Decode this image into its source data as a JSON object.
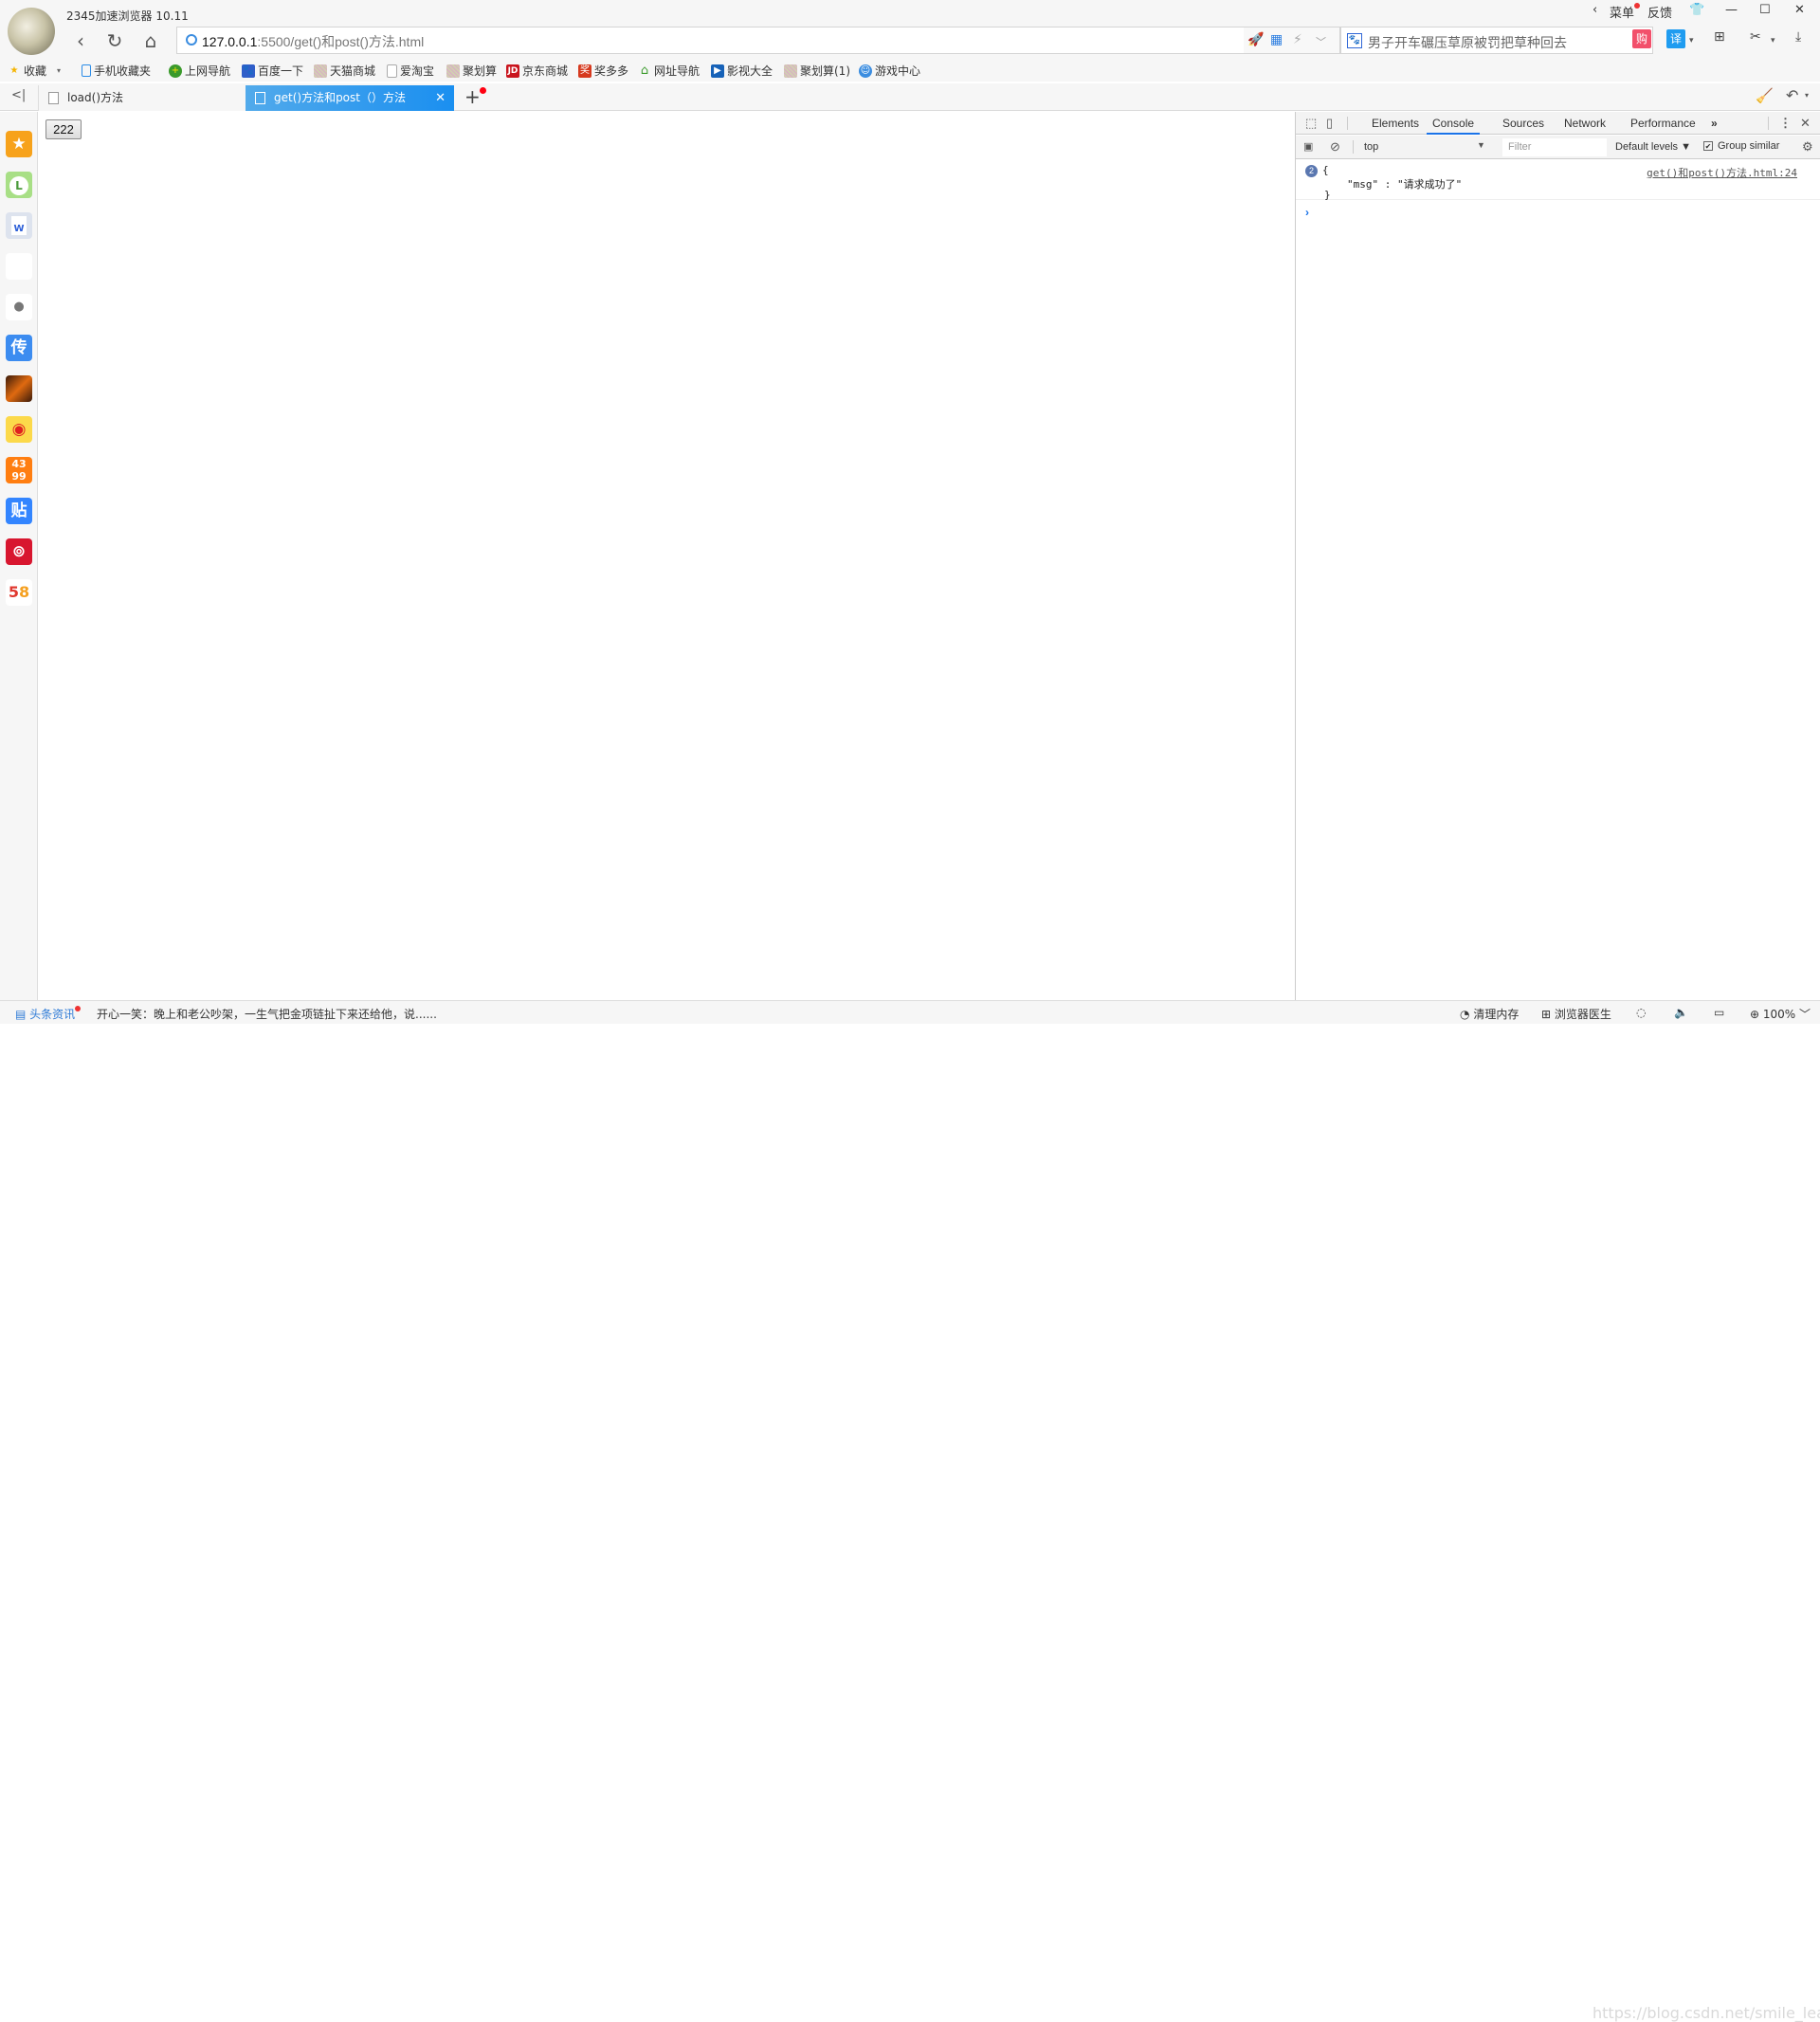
{
  "app": {
    "title": "2345加速浏览器 10.11"
  },
  "window_controls": {
    "menu_label": "菜单",
    "feedback_label": "反馈"
  },
  "addressbar": {
    "url_host": "127.0.0.1",
    "url_rest": ":5500/get()和post()方法.html"
  },
  "search": {
    "text": "男子开车碾压草原被罚把草种回去"
  },
  "bookmarks": [
    {
      "label": "收藏",
      "icon": "star-icon",
      "color": "#f5b400"
    },
    {
      "label": "手机收藏夹",
      "icon": "phone-icon",
      "color": "#2b8ce8"
    },
    {
      "label": "上网导航",
      "icon": "nav-plus-icon",
      "color": "#3a9a2b"
    },
    {
      "label": "百度一下",
      "icon": "baidu-paw-icon",
      "color": "#2f5ec9"
    },
    {
      "label": "天猫商城",
      "icon": "tmall-icon",
      "color": "#d9a8c8"
    },
    {
      "label": "爱淘宝",
      "icon": "page-icon",
      "color": "#bbbbbb"
    },
    {
      "label": "聚划算",
      "icon": "juhuasuan-icon",
      "color": "#d9a8c8"
    },
    {
      "label": "京东商城",
      "icon": "jd-icon",
      "color": "#c9151e"
    },
    {
      "label": "奖多多",
      "icon": "jiang-icon",
      "color": "#d63a1f"
    },
    {
      "label": "网址导航",
      "icon": "house-icon",
      "color": "#3a9a2b"
    },
    {
      "label": "影视大全",
      "icon": "video-icon",
      "color": "#1762b8"
    },
    {
      "label": "聚划算(1)",
      "icon": "juhuasuan-icon",
      "color": "#d9a8c8"
    },
    {
      "label": "游戏中心",
      "icon": "game-mascot-icon",
      "color": "#3b8de0"
    }
  ],
  "tabs": [
    {
      "label": "load()方法",
      "active": false
    },
    {
      "label": "get()方法和post（）方法",
      "active": true
    }
  ],
  "sidebar": [
    {
      "name": "favorites",
      "glyph": "★",
      "bg": "#f7a21b"
    },
    {
      "name": "history",
      "glyph": "L",
      "bg": "#8fd36a"
    },
    {
      "name": "word-doc",
      "glyph": "W",
      "bg": "#dde3ee"
    },
    {
      "name": "blank-app",
      "glyph": "",
      "bg": "#ffffff"
    },
    {
      "name": "apple",
      "glyph": "",
      "bg": "#ffffff"
    },
    {
      "name": "chuan",
      "glyph": "传",
      "bg": "#3c8cf0"
    },
    {
      "name": "game",
      "glyph": "⚔",
      "bg": "#5a2510"
    },
    {
      "name": "weibo",
      "glyph": "◉",
      "bg": "#fcd94a"
    },
    {
      "name": "4399",
      "glyph": "43",
      "bg": "#ff7e11"
    },
    {
      "name": "tieba",
      "glyph": "贴",
      "bg": "#3385ff"
    },
    {
      "name": "netease-music",
      "glyph": "♫",
      "bg": "#d8162f"
    },
    {
      "name": "58",
      "glyph": "58",
      "bg": "#ffffff"
    }
  ],
  "page": {
    "button_label": "222"
  },
  "devtools": {
    "tabs": [
      "Elements",
      "Console",
      "Sources",
      "Network",
      "Performance"
    ],
    "active_tab": "Console",
    "more_tabs": "»",
    "context": "top",
    "filter_placeholder": "Filter",
    "levels": "Default levels ▼",
    "group_similar": "Group similar",
    "group_similar_checked": true,
    "console": {
      "count": "2",
      "open_brace": "{",
      "entry_line": "\"msg\" : \"请求成功了\"",
      "close_brace": "}",
      "source": "get()和post()方法.html:24"
    },
    "prompt": "›"
  },
  "statusbar": {
    "news_label": "头条资讯",
    "news_text": "开心一笑：晚上和老公吵架，一生气把金项链扯下来还给他，说......",
    "clean_memory": "清理内存",
    "browser_doctor": "浏览器医生",
    "zoom": "100%",
    "watermark": "https://blog.csdn.net/smile_learn"
  }
}
